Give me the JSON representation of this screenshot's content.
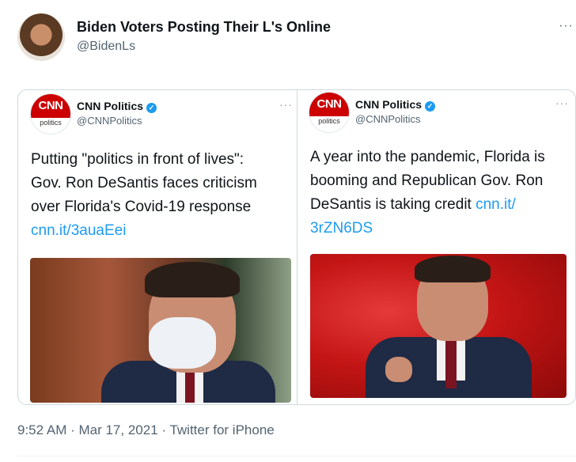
{
  "tweet": {
    "author_name": "Biden Voters Posting Their L's Online",
    "author_handle": "@BidenLs",
    "more_label": "···",
    "timestamp": "9:52 AM · Mar 17, 2021 · Twitter for iPhone"
  },
  "embeds": [
    {
      "logo_text": "CNN",
      "logo_sub": "politics",
      "name": "CNN Politics",
      "verified_icon": "✓",
      "handle": "@CNNPolitics",
      "more_label": "···",
      "text_lines": [
        "Putting \"politics in front of lives\":",
        "Gov. Ron DeSantis faces criticism",
        "over Florida's Covid-19 response"
      ],
      "link": "cnn.it/3auaEei"
    },
    {
      "logo_text": "CNN",
      "logo_sub": "politics",
      "name": "CNN Politics",
      "verified_icon": "✓",
      "handle": "@CNNPolitics",
      "more_label": "···",
      "text_lines": [
        "A year into the pandemic, Florida is",
        "booming and Republican Gov. Ron"
      ],
      "text_line3": "DeSantis is taking credit ",
      "link_part1": "cnn.it/",
      "link_part2": "3rZN6DS"
    }
  ],
  "colors": {
    "link": "#1d9bf0",
    "verified": "#1d9bf0",
    "cnn_red": "#cc0000",
    "secondary_text": "#536471"
  },
  "icons": {
    "verified": "verified-badge-icon",
    "more": "more-options-icon"
  }
}
